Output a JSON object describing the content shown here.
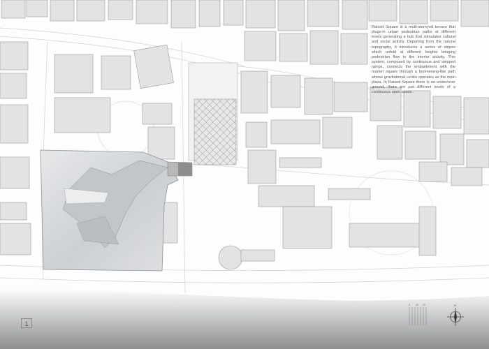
{
  "description": "Raised Square is a multi-storeyed terrace that plugs-in urban pedestrian paths at different levels generating a hub that stimulates cultural and social activity. Departing from the natural topography, it introduces a series of stripes which unfold at different heights bringing pedestrian flow to the interior activity. This system, composed by continuous and stepped ramps, connects the embankment with the market square through a boomerang-like path whose gravitational centre operates as the main plaza. In Raised Square there is no under/over ground, there are just different levels of a continuous open space.",
  "page_number": "1",
  "compass_label": "N",
  "scale_labels": [
    "0",
    "10",
    "20"
  ],
  "colors": {
    "background": "#fdfdfd",
    "building_fill": "#e3e3e3",
    "building_stroke": "#9a9a9a",
    "project_fill": "#d2d5d8",
    "water_gradient_top": "#ffffff",
    "water_gradient_bottom": "#8d8e90"
  }
}
